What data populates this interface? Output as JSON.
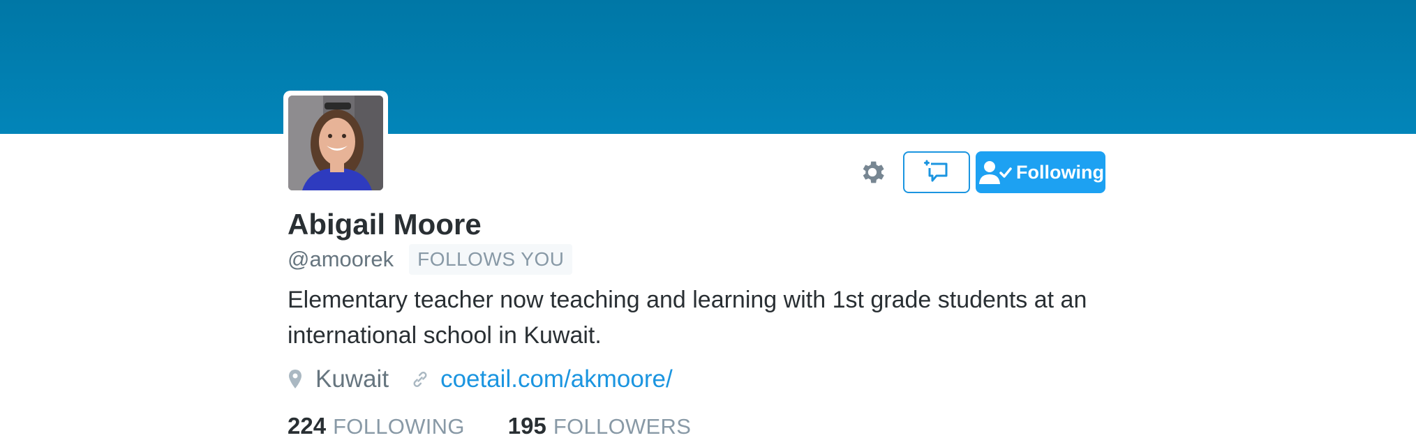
{
  "profile": {
    "name": "Abigail Moore",
    "handle": "@amoorek",
    "follows_you_label": "FOLLOWS YOU",
    "bio": "Elementary teacher now teaching and learning with 1st grade students at an international school in Kuwait.",
    "location": "Kuwait",
    "website": "coetail.com/akmoore/",
    "banner_color": "#0280b3"
  },
  "actions": {
    "settings_icon": "gear-icon",
    "message_icon": "new-message-icon",
    "following_label": "Following",
    "following_icon": "user-check-icon",
    "accent_color": "#1da1f2"
  },
  "stats": {
    "following_count": "224",
    "following_label": "FOLLOWING",
    "followers_count": "195",
    "followers_label": "FOLLOWERS"
  }
}
